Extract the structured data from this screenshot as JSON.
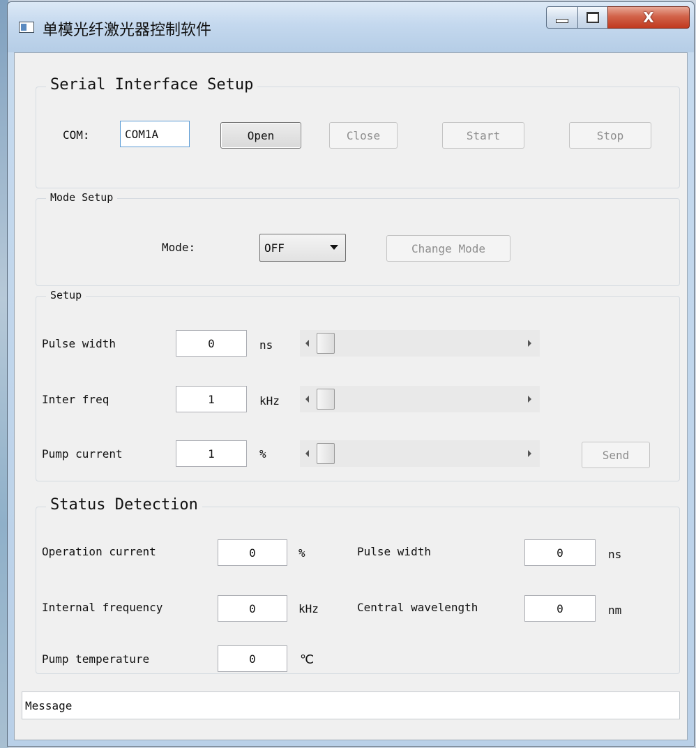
{
  "window": {
    "title": "单模光纤激光器控制软件",
    "icons": {
      "minimize": "minimize-icon",
      "maximize": "maximize-icon",
      "close": "close-icon"
    },
    "close_glyph": "X"
  },
  "serial": {
    "legend": "Serial Interface Setup",
    "com_label": "COM:",
    "com_value": "COM1A",
    "open_label": "Open",
    "close_label": "Close",
    "start_label": "Start",
    "stop_label": "Stop"
  },
  "mode": {
    "legend": "Mode Setup",
    "mode_label": "Mode:",
    "selected": "OFF",
    "change_label": "Change Mode"
  },
  "setup": {
    "legend": "Setup",
    "rows": [
      {
        "label": "Pulse width",
        "value": "0",
        "unit": "ns",
        "slider_level": 0
      },
      {
        "label": "Inter freq",
        "value": "1",
        "unit": "kHz",
        "slider_level": 0
      },
      {
        "label": "Pump current",
        "value": "1",
        "unit": "%",
        "slider_level": 0
      }
    ],
    "send_label": "Send"
  },
  "status": {
    "legend": "Status Detection",
    "operation_current": {
      "label": "Operation current",
      "value": "0",
      "unit": "%"
    },
    "pulse_width": {
      "label": "Pulse width",
      "value": "0",
      "unit": "ns"
    },
    "internal_frequency": {
      "label": "Internal frequency",
      "value": "0",
      "unit": "kHz"
    },
    "central_wavelength": {
      "label": "Central wavelength",
      "value": "0",
      "unit": "nm"
    },
    "pump_temperature": {
      "label": "Pump temperature",
      "value": "0",
      "unit": "℃"
    }
  },
  "message": "Message",
  "colors": {
    "close_button": "#c0391f",
    "focus_border": "#5a9bd5",
    "titlebar": "#c4d8ee"
  }
}
